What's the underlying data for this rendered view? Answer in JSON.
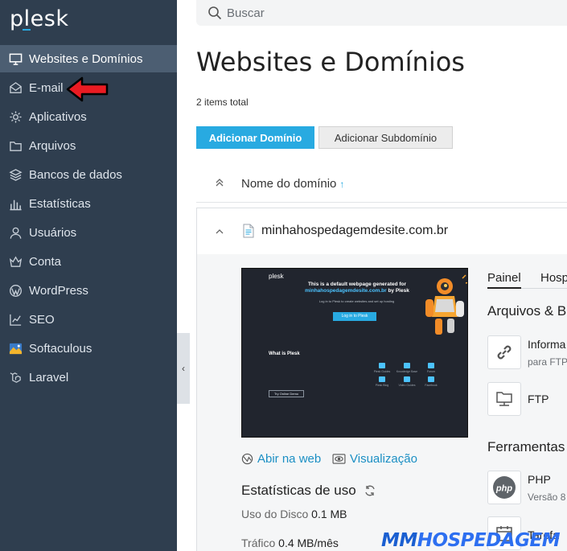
{
  "sidebar": {
    "logo": "plesk",
    "items": [
      {
        "label": "Websites e Domínios",
        "icon": "monitor-icon",
        "active": true
      },
      {
        "label": "E-mail",
        "icon": "envelope-icon"
      },
      {
        "label": "Aplicativos",
        "icon": "gear-icon"
      },
      {
        "label": "Arquivos",
        "icon": "folder-icon"
      },
      {
        "label": "Bancos de dados",
        "icon": "database-icon"
      },
      {
        "label": "Estatísticas",
        "icon": "bar-chart-icon"
      },
      {
        "label": "Usuários",
        "icon": "user-icon"
      },
      {
        "label": "Conta",
        "icon": "crown-icon"
      },
      {
        "label": "WordPress",
        "icon": "wordpress-icon"
      },
      {
        "label": "SEO",
        "icon": "seo-chart-icon"
      },
      {
        "label": "Softaculous",
        "icon": "softaculous-icon"
      },
      {
        "label": "Laravel",
        "icon": "laravel-icon"
      }
    ]
  },
  "search": {
    "placeholder": "Buscar"
  },
  "page": {
    "title": "Websites e Domínios",
    "items_total": "2 items total",
    "add_domain": "Adicionar Domínio",
    "add_subdomain": "Adicionar Subdomínio",
    "column_header": "Nome do domínio",
    "sort_indicator": "↑"
  },
  "domain": {
    "name": "minhahospedagemdesite.com.br",
    "open_web": "Abir na web",
    "preview": "Visualização",
    "stats_title": "Estatísticas de uso",
    "disk_label": "Uso do Disco",
    "disk_value": "0.1 MB",
    "traffic_label": "Tráfico",
    "traffic_value": "0.4 MB/mês"
  },
  "preview_site": {
    "logo": "plesk",
    "title_line1": "This is a default webpage generated for",
    "title_domain": "minhahospedagemdesite.com.br",
    "title_line2": "by Plesk",
    "text": "Log in to Plesk to create websites and set up hosting",
    "button": "Log in to Plesk",
    "what_is": "What is Plesk",
    "try_demo": "Try Online Demo",
    "features": [
      "Plesk Guides",
      "Knowledge Base",
      "Forum",
      "Plesk Blog",
      "Video Guides",
      "Facebook"
    ]
  },
  "panel": {
    "tabs": [
      "Painel",
      "Hosp"
    ],
    "files_section": "Arquivos & B",
    "tool1_name": "Informa",
    "tool1_sub": "para FTP",
    "tool2_name": "FTP",
    "tools_section": "Ferramentas",
    "tool3_name": "PHP",
    "tool3_sub": "Versão 8",
    "tool4_name": "Tarefa"
  },
  "watermark": {
    "part1": "MM",
    "part2": "HOSPEDAGEM"
  },
  "colors": {
    "sidebar": "#2f3e4f",
    "active": "#4c5e72",
    "accent": "#28aae1",
    "link": "#1b8fc4"
  }
}
